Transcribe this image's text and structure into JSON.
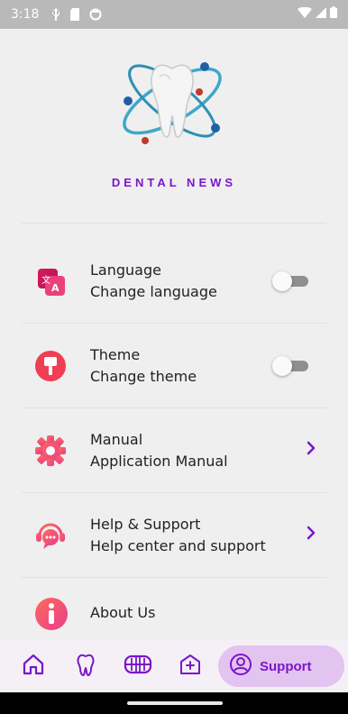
{
  "status_bar": {
    "time": "3:18"
  },
  "header": {
    "title": "DENTAL NEWS"
  },
  "settings": [
    {
      "title": "Language",
      "subtitle": "Change language",
      "icon": "translate-icon",
      "control": "toggle",
      "enabled": false
    },
    {
      "title": "Theme",
      "subtitle": "Change theme",
      "icon": "paint-roller-icon",
      "control": "toggle",
      "enabled": false
    },
    {
      "title": "Manual",
      "subtitle": "Application Manual",
      "icon": "gear-icon",
      "control": "chevron"
    },
    {
      "title": "Help & Support",
      "subtitle": "Help center and support",
      "icon": "support-chat-icon",
      "control": "chevron"
    },
    {
      "title": "About Us",
      "subtitle": "",
      "icon": "info-icon",
      "control": "none"
    }
  ],
  "bottom_nav": {
    "items": [
      {
        "icon": "home-icon"
      },
      {
        "icon": "tooth-icon"
      },
      {
        "icon": "dentures-icon"
      },
      {
        "icon": "clinic-icon"
      },
      {
        "icon": "person-icon",
        "label": "Support",
        "selected": true
      }
    ]
  },
  "colors": {
    "accent": "#7b16c9",
    "nav_pill": "#e3c3f0",
    "background": "#efefef"
  }
}
